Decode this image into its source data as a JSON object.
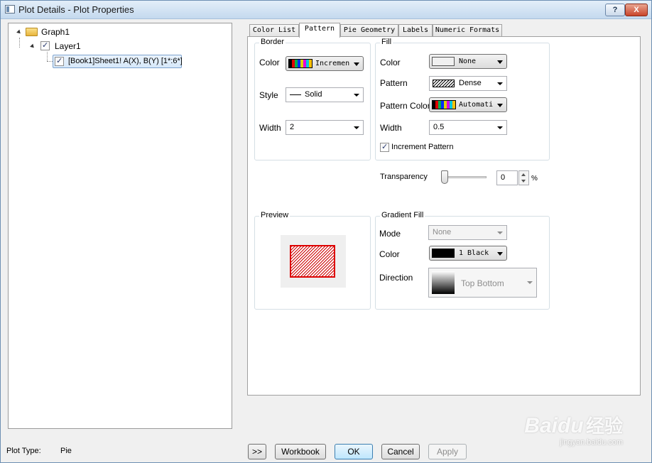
{
  "window": {
    "title": "Plot Details - Plot Properties",
    "help_label": "?",
    "close_label": "X"
  },
  "tree": {
    "graph": "Graph1",
    "layer": "Layer1",
    "plot": "[Book1]Sheet1! A(X), B(Y) [1*:6*]"
  },
  "tabs": [
    "Color List",
    "Pattern",
    "Pie Geometry",
    "Labels",
    "Numeric Formats"
  ],
  "active_tab": "Pattern",
  "border": {
    "title": "Border",
    "color_label": "Color",
    "color_value": "Incremen",
    "style_label": "Style",
    "style_value": "Solid",
    "width_label": "Width",
    "width_value": "2"
  },
  "fill": {
    "title": "Fill",
    "color_label": "Color",
    "color_value": "None",
    "pattern_label": "Pattern",
    "pattern_value": "Dense",
    "pattern_color_label": "Pattern Color",
    "pattern_color_value": "Automati",
    "width_label": "Width",
    "width_value": "0.5",
    "increment_label": "Increment Pattern",
    "increment_checked": true
  },
  "transparency": {
    "label": "Transparency",
    "value": "0",
    "unit": "%",
    "level": 0
  },
  "preview": {
    "title": "Preview",
    "fill_color": "#cc0000",
    "border_color": "#dd0000"
  },
  "gradient": {
    "title": "Gradient Fill",
    "mode_label": "Mode",
    "mode_value": "None",
    "color_label": "Color",
    "color_value": "1 Black",
    "direction_label": "Direction",
    "direction_value": "Top Bottom"
  },
  "footer": {
    "plot_type_label": "Plot Type:",
    "plot_type_value": "Pie",
    "expand_label": ">>",
    "workbook_label": "Workbook",
    "ok_label": "OK",
    "cancel_label": "Cancel",
    "apply_label": "Apply"
  },
  "watermark": {
    "brand": "Baidu",
    "brand_cn": "经验",
    "url": "jingyan.baidu.com"
  }
}
